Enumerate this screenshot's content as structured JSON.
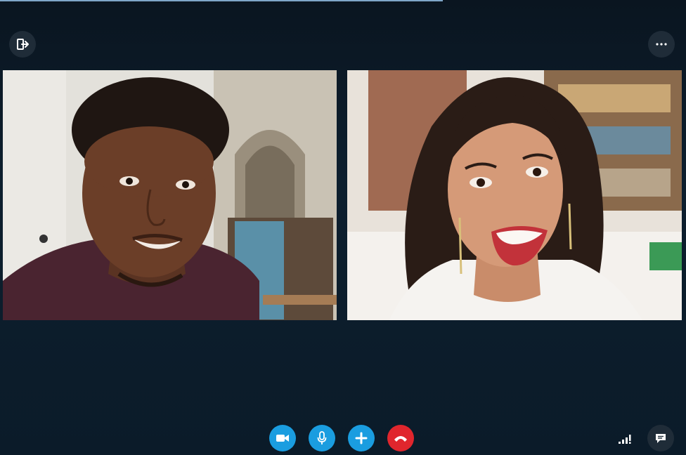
{
  "window": {
    "accent": "#1a9de0",
    "end_call_color": "#e0262d",
    "background": "#0b1a27"
  },
  "top_bar": {
    "exit_icon": "exit-door-icon",
    "more_icon": "more-ellipsis-icon"
  },
  "participants": [
    {
      "video": "participant-left-video"
    },
    {
      "video": "participant-right-video"
    }
  ],
  "controls": {
    "video_icon": "camera-icon",
    "mic_icon": "microphone-icon",
    "add_icon": "plus-icon",
    "end_icon": "hang-up-icon",
    "signal_icon": "signal-strength-icon",
    "chat_icon": "chat-bubble-icon"
  }
}
